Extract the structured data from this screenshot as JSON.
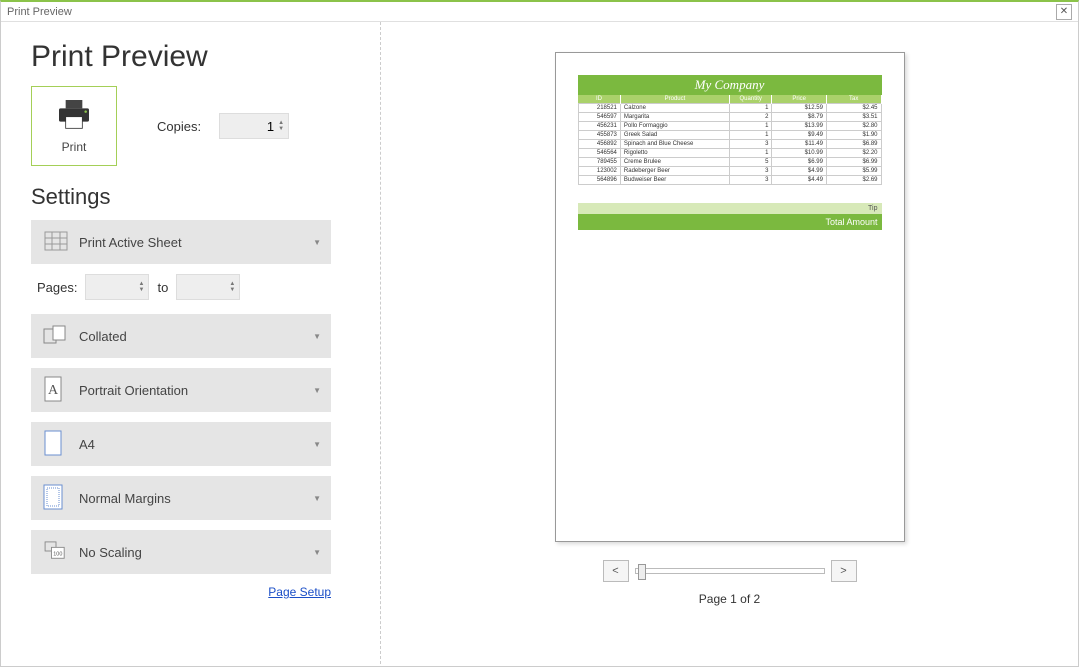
{
  "window": {
    "title": "Print Preview"
  },
  "header": {
    "title": "Print Preview"
  },
  "print": {
    "button_label": "Print",
    "copies_label": "Copies:",
    "copies_value": "1"
  },
  "settings": {
    "title": "Settings",
    "print_sheet": "Print Active Sheet",
    "pages_label": "Pages:",
    "pages_from": "",
    "pages_to_label": "to",
    "pages_to": "",
    "collated": "Collated",
    "orientation": "Portrait Orientation",
    "paper": "A4",
    "margins": "Normal Margins",
    "scaling": "No Scaling",
    "page_setup": "Page Setup"
  },
  "doc": {
    "company": "My Company",
    "columns": [
      "ID",
      "Product",
      "Quantity",
      "Price",
      "Tax"
    ],
    "rows": [
      {
        "id": "218521",
        "product": "Calzone",
        "qty": "1",
        "price": "$12.59",
        "tax": "$2.45"
      },
      {
        "id": "546597",
        "product": "Margarita",
        "qty": "2",
        "price": "$8.79",
        "tax": "$3.51"
      },
      {
        "id": "456231",
        "product": "Pollo Formaggio",
        "qty": "1",
        "price": "$13.99",
        "tax": "$2.80"
      },
      {
        "id": "455873",
        "product": "Greek Salad",
        "qty": "1",
        "price": "$9.49",
        "tax": "$1.90"
      },
      {
        "id": "456892",
        "product": "Spinach and Blue Cheese",
        "qty": "3",
        "price": "$11.49",
        "tax": "$6.89"
      },
      {
        "id": "546564",
        "product": "Rigoletto",
        "qty": "1",
        "price": "$10.99",
        "tax": "$2.20"
      },
      {
        "id": "789455",
        "product": "Creme Brulee",
        "qty": "5",
        "price": "$6.99",
        "tax": "$6.99"
      },
      {
        "id": "123002",
        "product": "Radeberger Beer",
        "qty": "3",
        "price": "$4.99",
        "tax": "$5.99"
      },
      {
        "id": "564896",
        "product": "Budweiser Beer",
        "qty": "3",
        "price": "$4.49",
        "tax": "$2.69"
      }
    ],
    "tip_label": "Tip",
    "total_label": "Total Amount"
  },
  "nav": {
    "prev": "<",
    "next": ">",
    "indicator": "Page 1 of 2"
  }
}
